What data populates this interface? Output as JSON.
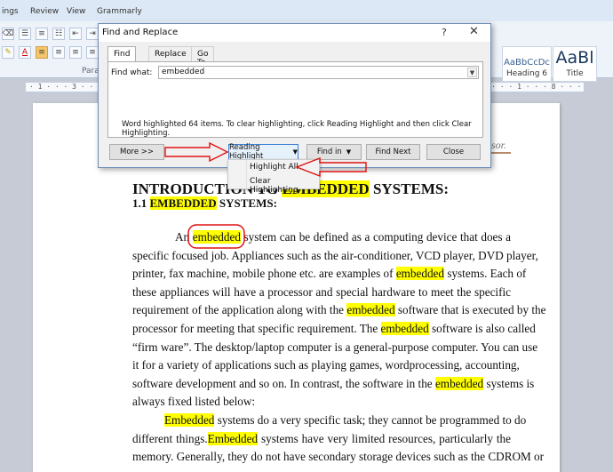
{
  "ribbon": {
    "menu_tabs": [
      "ings",
      "Review",
      "View",
      "Grammarly"
    ],
    "group_label": "Parag",
    "styles": [
      {
        "sample": "AaBbCcDc",
        "name": "Heading 6"
      },
      {
        "sample": "AaBl",
        "name": "Title"
      }
    ]
  },
  "ruler": {
    "text": "· 1 · · · 3 · · · 1 · · · 2 · · · 1 · · · 3 · · · 1 · · · 4 · · · 1 · · · 5 · · · 1 · · · 6 · · · 1 · · · 7 · · · 1 · · · 8 · · · 1 · · · 9 · · · 1 · · · 10 · · · 1 · · · 11 · · · 1 · · · 12 · · · 1 · · · 13 · · · 1 · · · 14 · · · 1 · · · 15 · · · 1 · · · 16 · · · 1"
  },
  "dialog": {
    "title": "Find and Replace",
    "help": "?",
    "close": "✕",
    "tabs": [
      "Find",
      "Replace",
      "Go To"
    ],
    "find_label": "Find what:",
    "find_value": "embedded",
    "status": "Word highlighted 64 items. To clear highlighting, click Reading Highlight and then click Clear Highlighting.",
    "buttons": {
      "more": "More >>",
      "reading_highlight": "Reading Highlight",
      "find_in": "Find in",
      "find_next": "Find Next",
      "close": "Close"
    }
  },
  "reading_menu": {
    "items": [
      "Highlight All",
      "Clear Highlighting"
    ]
  },
  "document": {
    "header_tail": "sor.",
    "heading1": {
      "pre": "INTRODUCTION TO ",
      "hl": "EMBEDDED",
      "post": " SYSTEMS:"
    },
    "heading2": {
      "pre": "1.1 ",
      "hl": "EMBEDDED",
      "post": " SYSTEMS:"
    },
    "para1": [
      [
        "An ",
        "embedded",
        " system can be defined as a computing device that does a"
      ],
      [
        "specific focused job. Appliances such as the air-conditioner, VCD player, DVD player,",
        "",
        ""
      ],
      [
        "printer, fax machine, mobile phone etc. are examples of ",
        "embedded",
        " systems. Each of"
      ],
      [
        "these appliances will have a processor and special hardware to meet the specific",
        "",
        ""
      ],
      [
        "requirement of the application along with the ",
        "embedded",
        " software that is executed by the"
      ],
      [
        "processor for meeting that specific requirement. The ",
        "embedded",
        " software is also called"
      ],
      [
        "“firm ware”. The desktop/laptop computer is a general-purpose computer. You can use",
        "",
        ""
      ],
      [
        "it for a variety of applications such as playing games, wordprocessing, accounting,",
        "",
        ""
      ],
      [
        "software development and so on. In contrast, the software in the ",
        "embedded",
        " systems is"
      ],
      [
        "always fixed listed below:",
        "",
        ""
      ]
    ],
    "para2": [
      [
        "",
        "Embedded",
        " systems do a very specific task; they cannot be programmed to do"
      ],
      [
        "different things.",
        "Embedded",
        " systems have very limited resources, particularly the"
      ],
      [
        "memory. Generally, they do not have secondary storage devices such as the CDROM or",
        "",
        ""
      ]
    ]
  },
  "colors": {
    "highlight": "#ffff00",
    "annotation_red": "#e01010",
    "dialog_border": "#6f8fb8"
  }
}
